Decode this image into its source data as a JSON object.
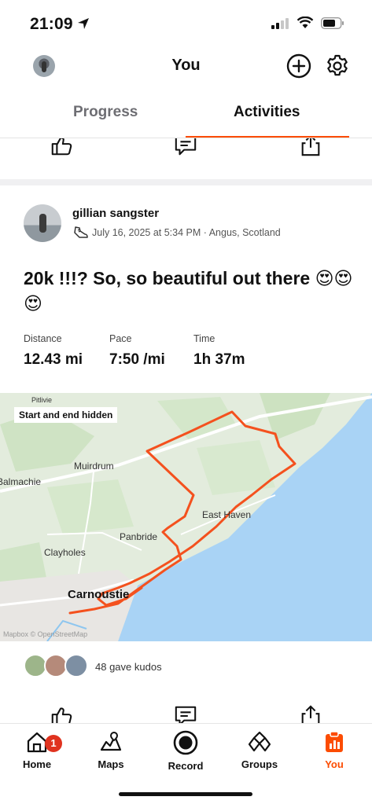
{
  "status_bar": {
    "time": "21:09"
  },
  "header": {
    "title": "You"
  },
  "tabs": [
    {
      "label": "Progress",
      "active": false
    },
    {
      "label": "Activities",
      "active": true
    }
  ],
  "activity": {
    "athlete_name": "gillian sangster",
    "meta": "July 16, 2025 at 5:34 PM · Angus, Scotland",
    "title": "20k !!!? So, so beautiful out there 😍😍😍",
    "stats": [
      {
        "label": "Distance",
        "value": "12.43 mi"
      },
      {
        "label": "Pace",
        "value": "7:50 /mi"
      },
      {
        "label": "Time",
        "value": "1h 37m"
      }
    ],
    "map": {
      "badge": "Start and end hidden",
      "labels": {
        "pitlivie": "Pitlivie",
        "muirdrum": "Muirdrum",
        "balmachie": "Balmachie",
        "east_haven": "East Haven",
        "panbride": "Panbride",
        "clayholes": "Clayholes",
        "carnoustie": "Carnoustie"
      },
      "attribution": "Mapbox © OpenStreetMap"
    },
    "kudos_text": "48 gave kudos"
  },
  "nav": {
    "home": "Home",
    "home_badge": "1",
    "maps": "Maps",
    "record": "Record",
    "groups": "Groups",
    "you": "You"
  },
  "colors": {
    "accent": "#fc4c02",
    "route": "#f4511e",
    "sea": "#a9d3f5"
  }
}
